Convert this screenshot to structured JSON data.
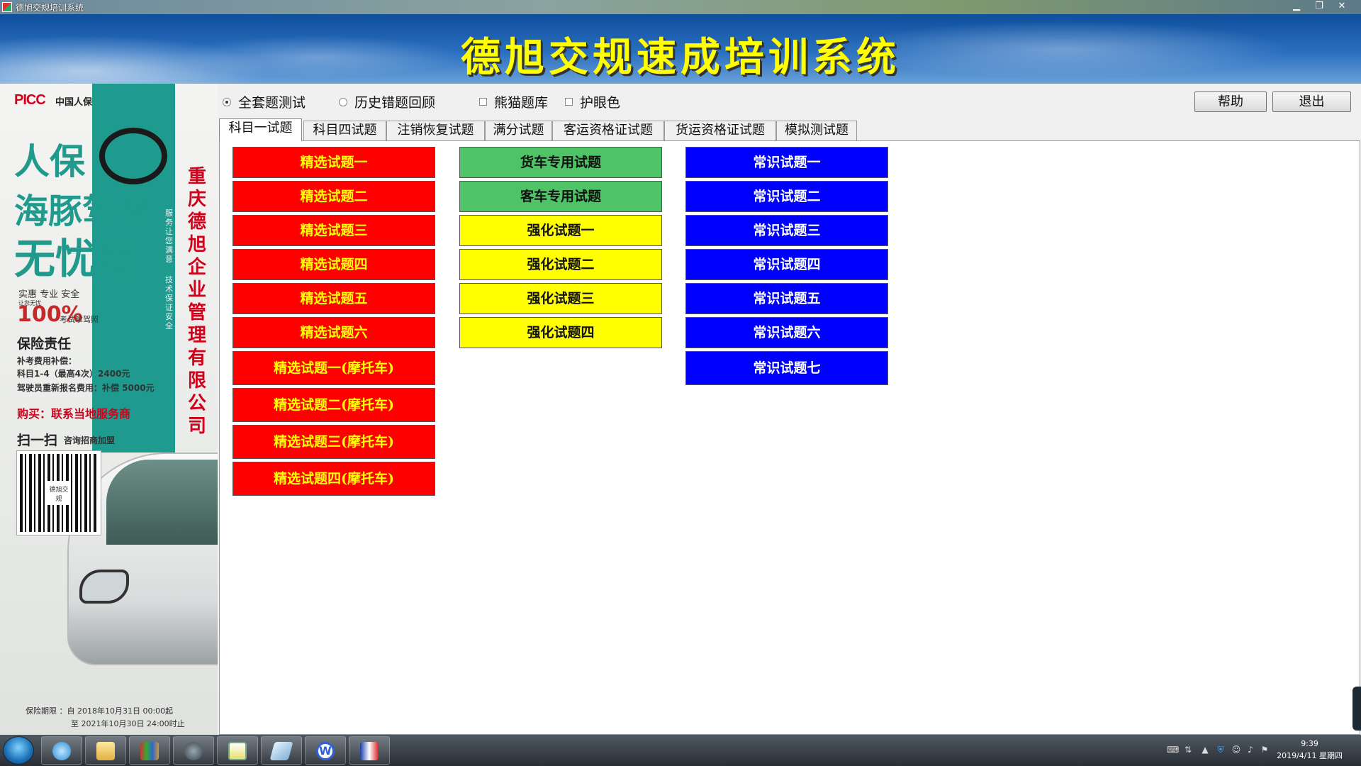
{
  "window": {
    "title": "德旭交规培训系统"
  },
  "banner": {
    "title": "德旭交规速成培训系统"
  },
  "ad": {
    "logo_text": "PICC",
    "logo_cn": "中国人保",
    "headline_1": "人保",
    "headline_2": "海豚驾考",
    "headline_3": "无忧险",
    "slogan_v1": "服务让您满意",
    "slogan_v2": "技术保证安全",
    "features": "实惠 专业 安全",
    "note_small": "让您无忧",
    "big_percent": "100%",
    "license_text": "考试拿驾照",
    "responsibility": "保险责任",
    "supplement_title": "补考费用补偿：",
    "supplement_line": "科目1-4（最高4次）2400元",
    "reenroll_line": "驾驶员重新报名费用：补偿 5000元",
    "buy_text": "购买：联系当地服务商",
    "scan_text": "扫一扫",
    "scan_sub": "咨询招商加盟",
    "qr_label": "德旭交规",
    "company_vertical": "重庆德旭企业管理有限公司",
    "period_1": "保险期限 ：自 2018年10月31日 00:00起",
    "period_2": "至 2021年10月30日 24:00时止"
  },
  "options": {
    "radio_full": "全套题测试",
    "radio_history": "历史错题回顾",
    "check_panda": "熊猫题库",
    "check_eye": "护眼色"
  },
  "buttons": {
    "help": "帮助",
    "exit": "退出"
  },
  "tabs": [
    "科目一试题",
    "科目四试题",
    "注销恢复试题",
    "满分试题",
    "客运资格证试题",
    "货运资格证试题",
    "模拟测试题"
  ],
  "columns": {
    "col1": [
      "精选试题一",
      "精选试题二",
      "精选试题三",
      "精选试题四",
      "精选试题五",
      "精选试题六",
      "精选试题一(摩托车)",
      "精选试题二(摩托车)",
      "精选试题三(摩托车)",
      "精选试题四(摩托车)"
    ],
    "col2": [
      "货车专用试题",
      "客车专用试题",
      "强化试题一",
      "强化试题二",
      "强化试题三",
      "强化试题四"
    ],
    "col3": [
      "常识试题一",
      "常识试题二",
      "常识试题三",
      "常识试题四",
      "常识试题五",
      "常识试题六",
      "常识试题七"
    ]
  },
  "colors": {
    "red": "#ff0000",
    "green": "#4fc466",
    "yellow": "#ffff00",
    "blue": "#0000ff",
    "banner_text": "#ffff00"
  },
  "taskbar": {
    "time": "9:39",
    "date": "2019/4/11 星期四",
    "apps": [
      "browser-icon",
      "folder-icon",
      "winrar-icon",
      "globe-icon",
      "notepad-icon",
      "eraser-icon",
      "wps-icon",
      "app-icon"
    ]
  }
}
